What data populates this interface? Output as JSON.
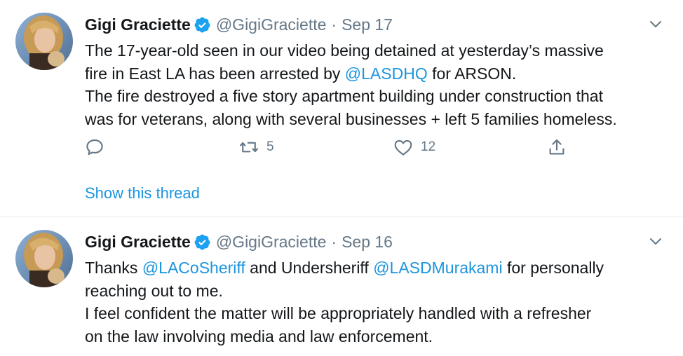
{
  "colors": {
    "link": "#1b95e0",
    "secondary": "#657786",
    "text": "#14171a",
    "verified": "#1da1f2",
    "divider": "#e6ecf0"
  },
  "tweets": [
    {
      "name": "Gigi Graciette",
      "handle": "@GigiGraciette",
      "separator": "·",
      "date": "Sep 17",
      "lines": [
        {
          "before": "The 17-year-old seen in our video being detained at yesterday’s massive",
          "mention": "",
          "after": ""
        },
        {
          "before": "fire in East LA has been arrested by ",
          "mention": "@LASDHQ",
          "after": " for ARSON."
        },
        {
          "before": "The fire destroyed a five story apartment building under construction that",
          "mention": "",
          "after": ""
        },
        {
          "before": "was for veterans, along with several businesses + left 5 families homeless.",
          "mention": "",
          "after": ""
        }
      ],
      "retweet_count": "5",
      "like_count": "12",
      "show_thread": "Show this thread",
      "icons": [
        "verified-badge-icon",
        "chevron-down-icon",
        "reply-icon",
        "retweet-icon",
        "heart-icon",
        "share-icon"
      ]
    },
    {
      "name": "Gigi Graciette",
      "handle": "@GigiGraciette",
      "separator": "·",
      "date": "Sep 16",
      "line1": {
        "before": "Thanks ",
        "mention1": "@LACoSheriff",
        "middle": " and Undersheriff ",
        "mention2": "@LASDMurakami",
        "after": " for personally"
      },
      "line2": "reaching out to me.",
      "line3": "I feel confident the matter will be appropriately handled with a refresher",
      "line4": "on the law involving media and law enforcement.",
      "icons": [
        "verified-badge-icon",
        "chevron-down-icon"
      ]
    }
  ]
}
